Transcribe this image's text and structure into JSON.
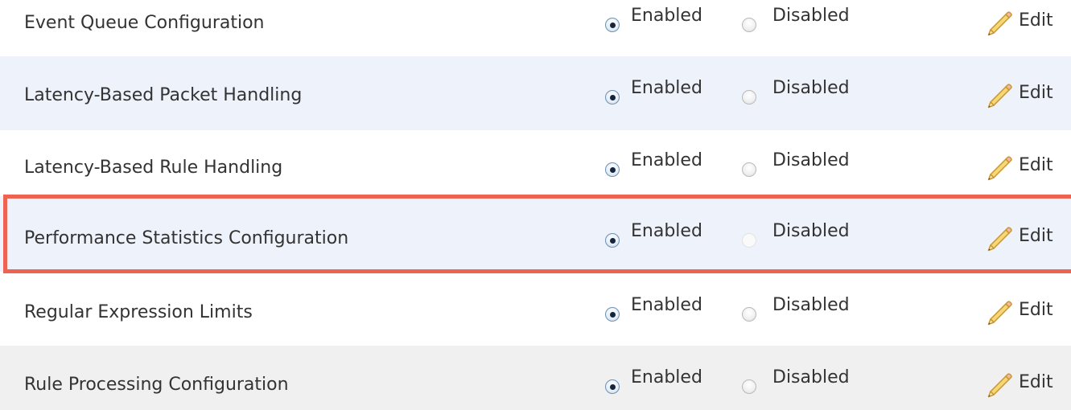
{
  "settings": {
    "rows": [
      {
        "name": "Event Queue Configuration",
        "enabled_label": "Enabled",
        "disabled_label": "Disabled",
        "edit_label": "Edit",
        "state": "enabled"
      },
      {
        "name": "Latency-Based Packet Handling",
        "enabled_label": "Enabled",
        "disabled_label": "Disabled",
        "edit_label": "Edit",
        "state": "enabled"
      },
      {
        "name": "Latency-Based Rule Handling",
        "enabled_label": "Enabled",
        "disabled_label": "Disabled",
        "edit_label": "Edit",
        "state": "enabled"
      },
      {
        "name": "Performance Statistics Configuration",
        "enabled_label": "Enabled",
        "disabled_label": "Disabled",
        "edit_label": "Edit",
        "state": "enabled",
        "highlighted": true
      },
      {
        "name": "Regular Expression Limits",
        "enabled_label": "Enabled",
        "disabled_label": "Disabled",
        "edit_label": "Edit",
        "state": "enabled"
      },
      {
        "name": "Rule Processing Configuration",
        "enabled_label": "Enabled",
        "disabled_label": "Disabled",
        "edit_label": "Edit",
        "state": "enabled"
      }
    ]
  },
  "icons": {
    "radio": "radio-icon",
    "edit": "pencil-icon"
  },
  "colors": {
    "row_alt_blue": "#eef2fa",
    "row_alt_gray": "#f0f0f0",
    "highlight_border": "#ee6252",
    "text": "#333333"
  }
}
